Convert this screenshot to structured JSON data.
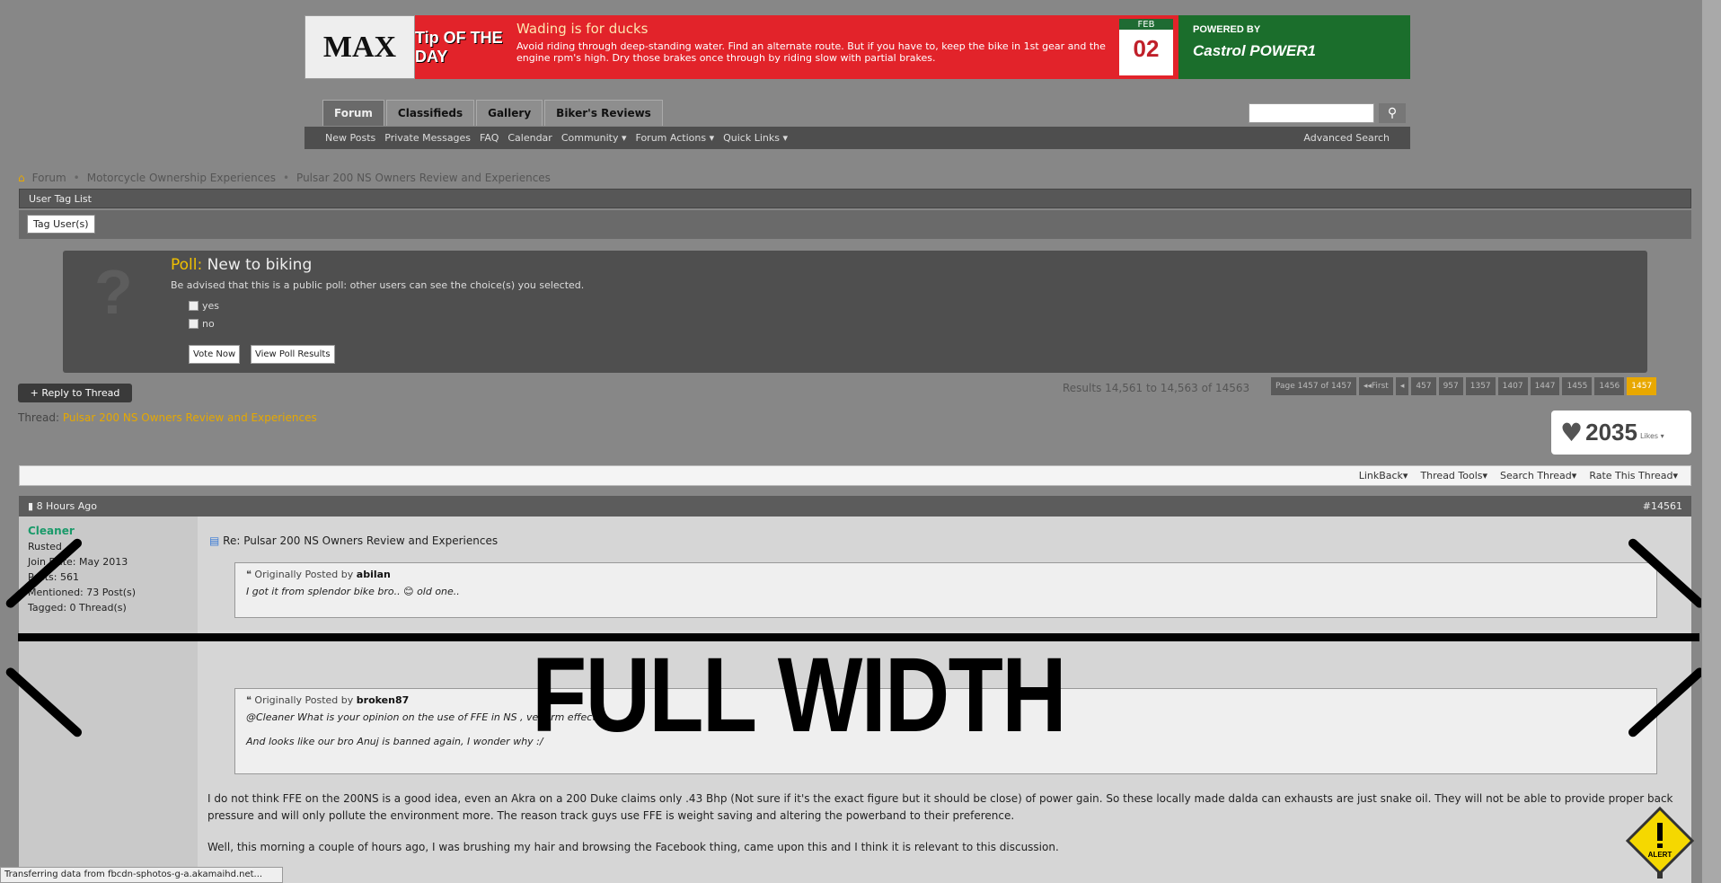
{
  "banner": {
    "logo": "MAX",
    "tip_label": "Tip OF THE DAY",
    "tip_title": "Wading is for ducks",
    "tip_body": "Avoid riding through deep-standing water. Find an alternate route. But if you have to, keep the bike in 1st gear and the engine rpm's high. Dry those brakes once through by riding slow with partial brakes.",
    "cal_month": "FEB",
    "cal_day": "02",
    "sponsor_pre": "POWERED BY",
    "sponsor": "Castrol POWER1"
  },
  "nav": {
    "tabs": [
      "Forum",
      "Classifieds",
      "Gallery",
      "Biker's Reviews"
    ],
    "subnav": [
      "New Posts",
      "Private Messages",
      "FAQ",
      "Calendar",
      "Community ▾",
      "Forum Actions ▾",
      "Quick Links ▾"
    ],
    "advanced_search": "Advanced Search",
    "search_placeholder": ""
  },
  "breadcrumb": [
    "Forum",
    "Motorcycle Ownership Experiences",
    "Pulsar 200 NS Owners Review and Experiences"
  ],
  "user_tag": {
    "title": "User Tag List",
    "button": "Tag User(s)"
  },
  "poll": {
    "label": "Poll:",
    "title": "New to biking",
    "desc": "Be advised that this is a public poll: other users can see the choice(s) you selected.",
    "options": [
      "yes",
      "no"
    ],
    "vote": "Vote Now",
    "results": "View Poll Results"
  },
  "thread": {
    "reply": "+ Reply to Thread",
    "prefix": "Thread:",
    "title": "Pulsar 200 NS Owners Review and Experiences",
    "results": "Results 14,561 to 14,563 of 14563",
    "pager": {
      "label": "Page 1457 of 1457",
      "first": "◂◂First",
      "prev": "◂",
      "pages": [
        "457",
        "957",
        "1357",
        "1407",
        "1447",
        "1455",
        "1456",
        "1457"
      ],
      "current": "1457"
    },
    "likes": "2035",
    "likes_label": "Likes ▾",
    "tools": [
      "LinkBack▾",
      "Thread Tools▾",
      "Search Thread▾",
      "Rate This Thread▾"
    ]
  },
  "post": {
    "time": "8 Hours Ago",
    "number": "#14561",
    "user": {
      "name": "Cleaner",
      "rank": "Rusted",
      "join": "Join Date: May 2013",
      "posts": "Posts: 561",
      "mentioned": "Mentioned: 73 Post(s)",
      "tagged": "Tagged: 0 Thread(s)"
    },
    "title": "Re: Pulsar 200 NS Owners Review and Experiences",
    "quotes": [
      {
        "by_label": "Originally Posted by",
        "author": "abilan",
        "lines": [
          "I got it from splendor bike bro.. 😊 old one.."
        ]
      },
      {
        "by_label": "Originally Posted by",
        "author": "broken87",
        "lines": [
          "@Cleaner What is your opinion on the use of FFE in NS , vegerm effect",
          "And looks like our bro Anuj is banned again, I wonder why :/"
        ]
      }
    ],
    "paragraphs": [
      "I do not think FFE on the 200NS is a good idea, even an Akra on a 200 Duke claims only .43 Bhp (Not sure if it's the exact figure but it should be close) of power gain. So these locally made dalda can exhausts are just snake oil. They will not be able to provide proper back pressure and will only pollute the environment more. The reason track guys use FFE is weight saving and altering the powerband to their preference.",
      "Well, this morning a couple of hours ago, I was brushing my hair and browsing the Facebook thing, came upon this and I think it is relevant to this discussion."
    ]
  },
  "overlay": {
    "text": "FULL WIDTH",
    "alert": "ALERT"
  },
  "status": "Transferring data from fbcdn-sphotos-g-a.akamaihd.net..."
}
